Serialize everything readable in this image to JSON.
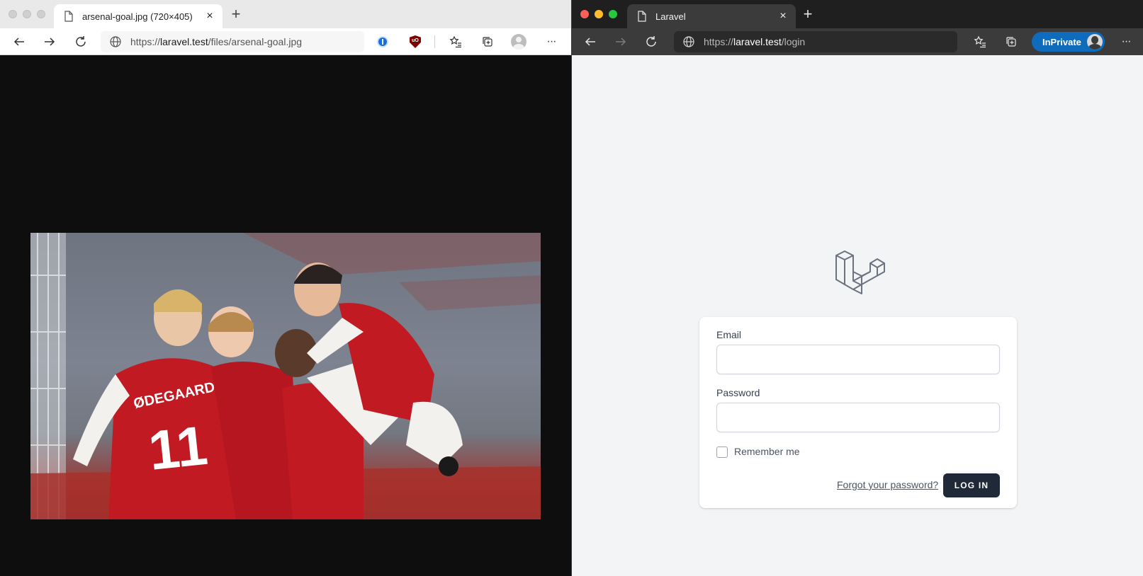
{
  "left_window": {
    "tab": {
      "title": "arsenal-goal.jpg (720×405)",
      "close_glyph": "×",
      "icon": "file-icon"
    },
    "new_tab_glyph": "+",
    "address": {
      "scheme": "https://",
      "host": "laravel.test",
      "path": "/files/arsenal-goal.jpg"
    },
    "extensions": [
      "onepassword-icon",
      "ublock-origin-icon"
    ],
    "more_glyph": "···",
    "image": {
      "alt": "Arsenal players celebrating a goal",
      "shirt_name": "ØDEGAARD",
      "shirt_number": "11"
    }
  },
  "right_window": {
    "tab": {
      "title": "Laravel",
      "close_glyph": "×",
      "icon": "file-icon"
    },
    "new_tab_glyph": "+",
    "address": {
      "scheme": "https://",
      "host": "laravel.test",
      "path": "/login"
    },
    "inprivate_label": "InPrivate",
    "more_glyph": "···",
    "form": {
      "email_label": "Email",
      "email_value": "",
      "password_label": "Password",
      "password_value": "",
      "remember_label": "Remember me",
      "remember_checked": false,
      "forgot_label": "Forgot your password?",
      "login_label": "LOG IN"
    }
  },
  "colors": {
    "viewer_bg": "#0e0e0f",
    "login_bg": "#f3f4f6",
    "login_button": "#1f2937",
    "inprivate_blue": "#0f6cbd",
    "laravel_logo": "#6b7280"
  }
}
